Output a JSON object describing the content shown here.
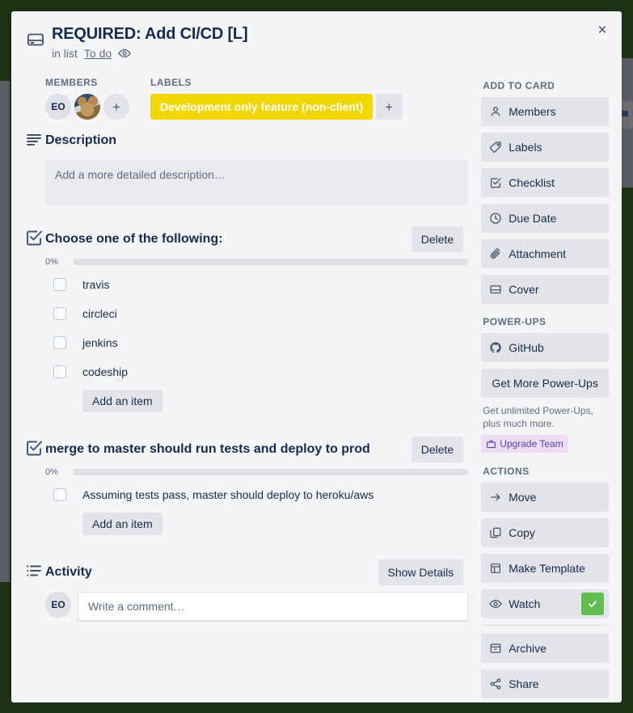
{
  "colors": {
    "board_background": "#1e3314",
    "label_yellow": "#f2d600",
    "watch_green": "#61bd4f",
    "upgrade_purple": "#5243aa",
    "modal_background": "#f4f5f7"
  },
  "header": {
    "card_icon": "card-icon",
    "title": "REQUIRED: Add CI/CD [L]",
    "in_list_prefix": "in list",
    "list_name": "To do",
    "watching_icon": "eye-icon",
    "close_label": "×"
  },
  "members": {
    "heading": "MEMBERS",
    "avatars": [
      {
        "type": "initials",
        "initials": "EO",
        "name": "avatar-eo"
      },
      {
        "type": "photo",
        "initials": "",
        "name": "avatar-photo"
      }
    ],
    "add_label": "+"
  },
  "labels": {
    "heading": "LABELS",
    "items": [
      {
        "text": "Development only feature (non-client)",
        "color": "#f2d600"
      }
    ],
    "add_label": "+"
  },
  "description": {
    "heading": "Description",
    "placeholder": "Add a more detailed description…"
  },
  "checklists": [
    {
      "title": "Choose one of the following:",
      "delete_label": "Delete",
      "percent_label": "0%",
      "percent": 0,
      "items": [
        {
          "text": "travis",
          "checked": false
        },
        {
          "text": "circleci",
          "checked": false
        },
        {
          "text": "jenkins",
          "checked": false
        },
        {
          "text": "codeship",
          "checked": false
        }
      ],
      "add_item_label": "Add an item"
    },
    {
      "title": "merge to master should run tests and deploy to prod",
      "delete_label": "Delete",
      "percent_label": "0%",
      "percent": 0,
      "items": [
        {
          "text": "Assuming tests pass, master should deploy to heroku/aws",
          "checked": false
        }
      ],
      "add_item_label": "Add an item"
    }
  ],
  "activity": {
    "heading": "Activity",
    "show_details_label": "Show Details",
    "avatar_initials": "EO",
    "comment_placeholder": "Write a comment…"
  },
  "sidebar": {
    "add_to_card": {
      "heading": "ADD TO CARD",
      "items": [
        {
          "label": "Members",
          "icon": "person-icon"
        },
        {
          "label": "Labels",
          "icon": "tag-icon"
        },
        {
          "label": "Checklist",
          "icon": "checklist-icon"
        },
        {
          "label": "Due Date",
          "icon": "clock-icon"
        },
        {
          "label": "Attachment",
          "icon": "paperclip-icon"
        },
        {
          "label": "Cover",
          "icon": "cover-icon"
        }
      ]
    },
    "power_ups": {
      "heading": "POWER-UPS",
      "items": [
        {
          "label": "GitHub",
          "icon": "github-icon"
        }
      ],
      "get_more_label": "Get More Power-Ups",
      "note": "Get unlimited Power-Ups, plus much more.",
      "upgrade_label": "Upgrade Team",
      "upgrade_icon": "briefcase-icon"
    },
    "actions": {
      "heading": "ACTIONS",
      "items": [
        {
          "label": "Move",
          "icon": "arrow-right-icon",
          "badge": ""
        },
        {
          "label": "Copy",
          "icon": "copy-icon",
          "badge": ""
        },
        {
          "label": "Make Template",
          "icon": "template-icon",
          "badge": ""
        },
        {
          "label": "Watch",
          "icon": "eye-icon",
          "badge": "check"
        }
      ],
      "secondary_items": [
        {
          "label": "Archive",
          "icon": "archive-icon"
        },
        {
          "label": "Share",
          "icon": "share-icon"
        }
      ]
    }
  }
}
